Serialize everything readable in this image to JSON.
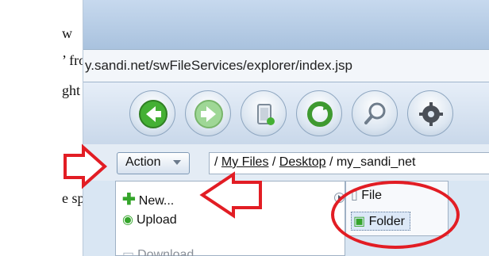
{
  "doc": {
    "line1": "w",
    "line2": "’ from",
    "line3": "ght",
    "line4": "e space"
  },
  "browser": {
    "url": "y.sandi.net/swFileServices/explorer/index.jsp"
  },
  "toolbar": {
    "buttons": [
      {
        "name": "back-arrow-icon"
      },
      {
        "name": "forward-arrow-icon"
      },
      {
        "name": "upload-file-icon"
      },
      {
        "name": "refresh-icon"
      },
      {
        "name": "search-icon"
      },
      {
        "name": "settings-gear-icon"
      }
    ]
  },
  "pathbar": {
    "action_label": "Action",
    "path_prefix": "/ ",
    "crumb1": "My Files",
    "sep1": " / ",
    "crumb2": "Desktop",
    "sep2": " / ",
    "crumb3": "my_sandi_net"
  },
  "menu": {
    "new_label": "New...",
    "upload_label": "Upload",
    "download_label": "Download"
  },
  "submenu": {
    "file_label": "File",
    "folder_label": "Folder"
  },
  "colors": {
    "annotation_red": "#e21d24",
    "ui_blue": "#c9d8ea",
    "arrow_green": "#35a52b"
  }
}
